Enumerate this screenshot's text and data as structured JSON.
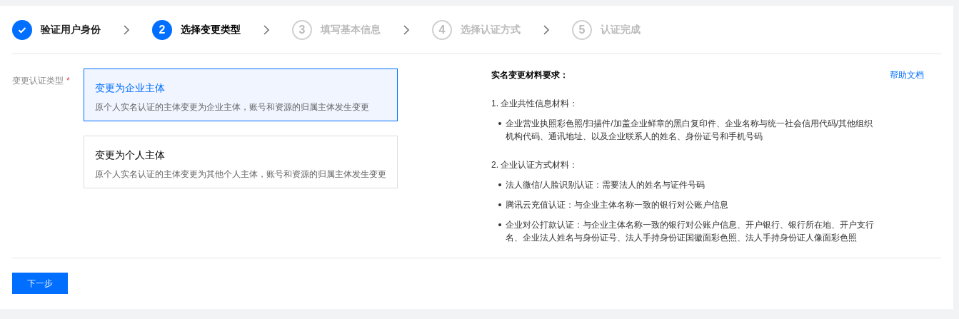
{
  "steps": [
    {
      "label": "验证用户身份",
      "completed": true,
      "selected": false
    },
    {
      "number": "2",
      "label": "选择变更类型",
      "completed": false,
      "selected": true
    },
    {
      "number": "3",
      "label": "填写基本信息",
      "completed": false,
      "selected": false
    },
    {
      "number": "4",
      "label": "选择认证方式",
      "completed": false,
      "selected": false
    },
    {
      "number": "5",
      "label": "认证完成",
      "completed": false,
      "selected": false
    }
  ],
  "form": {
    "label": "变更认证类型",
    "required_mark": "*",
    "options": [
      {
        "title": "变更为企业主体",
        "description": "原个人实名认证的主体变更为企业主体，账号和资源的归属主体发生变更",
        "selected": true
      },
      {
        "title": "变更为个人主体",
        "description": "原个人实名认证的主体变更为其他个人主体，账号和资源的归属主体发生变更",
        "selected": false
      }
    ]
  },
  "requirements": {
    "title": "实名变更材料要求：",
    "help_link": "帮助文档",
    "sections": [
      {
        "heading": "1. 企业共性信息材料：",
        "items": [
          "企业营业执照彩色照/扫描件/加盖企业鲜章的黑白复印件、企业名称与统一社会信用代码/其他组织机构代码、通讯地址、以及企业联系人的姓名、身份证号和手机号码"
        ]
      },
      {
        "heading": "2. 企业认证方式材料：",
        "items": [
          "法人微信/人脸识别认证：需要法人的姓名与证件号码",
          "腾讯云充值认证：与企业主体名称一致的银行对公账户信息",
          "企业对公打款认证：与企业主体名称一致的银行对公账户信息、开户银行、银行所在地、开户支行名、企业法人姓名与身份证号、法人手持身份证国徽面彩色照、法人手持身份证人像面彩色照"
        ]
      }
    ]
  },
  "next_button": "下一步"
}
